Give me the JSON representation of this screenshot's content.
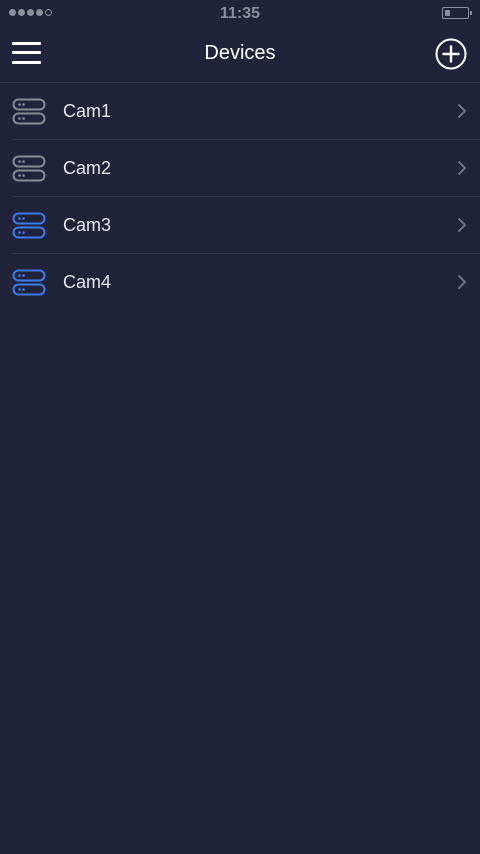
{
  "status_bar": {
    "time": "11:35",
    "signal_bars_filled": 4,
    "signal_bars_total": 5,
    "battery_level": 0.25
  },
  "nav": {
    "title": "Devices",
    "menu_icon": "hamburger-menu-icon",
    "add_icon": "plus-circle-icon"
  },
  "colors": {
    "background": "#21233a",
    "divider": "#34364c",
    "device_icon_offline": "#8a8b98",
    "device_icon_online": "#3c7bf0"
  },
  "devices": [
    {
      "name": "Cam1",
      "status": "offline",
      "icon": "server-icon"
    },
    {
      "name": "Cam2",
      "status": "offline",
      "icon": "server-icon"
    },
    {
      "name": "Cam3",
      "status": "online",
      "icon": "server-icon"
    },
    {
      "name": "Cam4",
      "status": "online",
      "icon": "server-icon"
    }
  ]
}
